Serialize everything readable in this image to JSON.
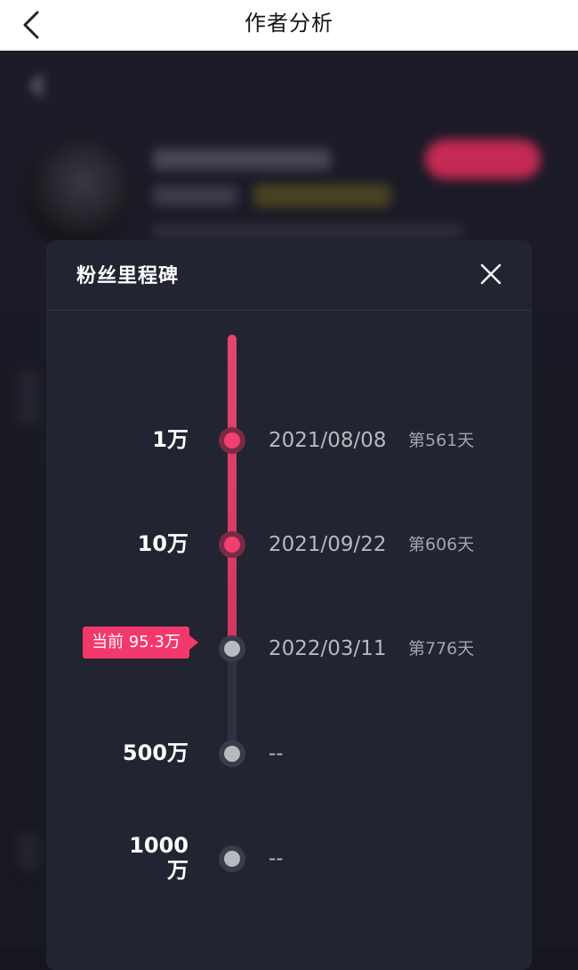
{
  "header": {
    "title": "作者分析",
    "back_icon": "chevron-left-icon"
  },
  "modal": {
    "title": "粉丝里程碑",
    "close_icon": "close-icon",
    "current_badge": "当前 95.3万",
    "milestones": [
      {
        "label": "1万",
        "date": "2021/08/08",
        "day": "第561天",
        "reached": true
      },
      {
        "label": "10万",
        "date": "2021/09/22",
        "day": "第606天",
        "reached": true
      },
      {
        "label": "",
        "date": "2022/03/11",
        "day": "第776天",
        "reached": false
      },
      {
        "label": "500万",
        "date": "--",
        "day": "",
        "reached": false
      },
      {
        "label_line1": "1000",
        "label_line2": "万",
        "date": "--",
        "day": "",
        "reached": false
      }
    ]
  },
  "colors": {
    "accent": "#f1406f",
    "modal_bg": "#222431",
    "page_bg": "#15161f"
  }
}
